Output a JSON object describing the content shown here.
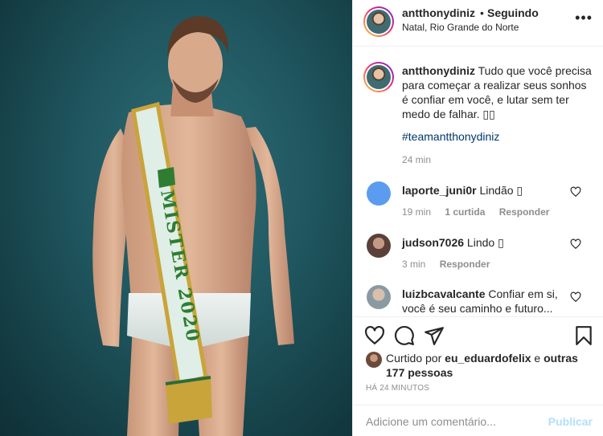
{
  "header": {
    "username": "antthonydiniz",
    "separator": "•",
    "follow_status": "Seguindo",
    "location": "Natal, Rio Grande do Norte",
    "more_icon": "more-horizontal-icon"
  },
  "photo": {
    "sash_text": "MISTER 2020",
    "colors": {
      "background": "#1f555e",
      "sash": "#dfeee6",
      "sash_border": "#c9a43a",
      "sash_text": "#2e7d32"
    }
  },
  "caption": {
    "username": "antthonydiniz",
    "text": "Tudo que você precisa para começar a realizar seus sonhos é confiar em você, e lutar sem ter medo de falhar. ▯▯",
    "hashtag": "#teamantthonydiniz",
    "time": "24 min"
  },
  "comments": [
    {
      "username": "laporte_juni0r",
      "text": "Lindão ▯",
      "time": "19 min",
      "likes": "1 curtida",
      "reply": "Responder",
      "avatar_color": "#5b9cf0"
    },
    {
      "username": "judson7026",
      "text": "Lindo ▯",
      "time": "3 min",
      "reply": "Responder",
      "avatar_color": "#8a6f63"
    },
    {
      "username": "luizbcavalcante",
      "text": "Confiar em si, você é seu caminho e futuro...",
      "avatar_color": "#b9a28f"
    }
  ],
  "actions": {
    "icons": [
      "heart-icon",
      "comment-icon",
      "share-icon",
      "bookmark-icon"
    ],
    "liked_by_prefix": "Curtido por",
    "liked_by_user": "eu_eduardofelix",
    "liked_by_joiner": "e",
    "others": "outras 177 pessoas",
    "time_ago": "HÁ 24 MINUTOS"
  },
  "add_comment": {
    "placeholder": "Adicione um comentário...",
    "publish_label": "Publicar"
  },
  "colors": {
    "link": "#00376b",
    "muted": "#8e8e8e",
    "publish_disabled": "#b2dffc",
    "divider": "#efefef"
  }
}
